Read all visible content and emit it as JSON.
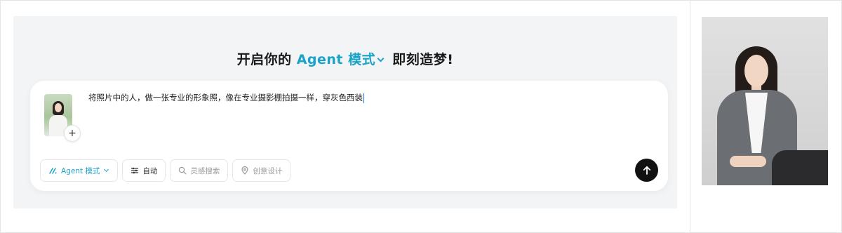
{
  "headline": {
    "prefix": "开启你的",
    "mode": "Agent 模式",
    "suffix": "即刻造梦!"
  },
  "composer": {
    "prompt_text": "将照片中的人，做一张专业的形象照，像在专业摄影棚拍摄一样，穿灰色西装",
    "add_label": "+"
  },
  "toolbar": {
    "agent_label": "Agent 模式",
    "auto_label": "自动",
    "search_label": "灵感搜索",
    "design_label": "创意设计"
  },
  "colors": {
    "accent": "#1aa3c8",
    "send": "#111111"
  },
  "icons": {
    "agent": "agent-mode-icon",
    "auto": "sliders-icon",
    "search": "search-icon",
    "design": "location-pin-icon",
    "send": "arrow-up-icon"
  }
}
